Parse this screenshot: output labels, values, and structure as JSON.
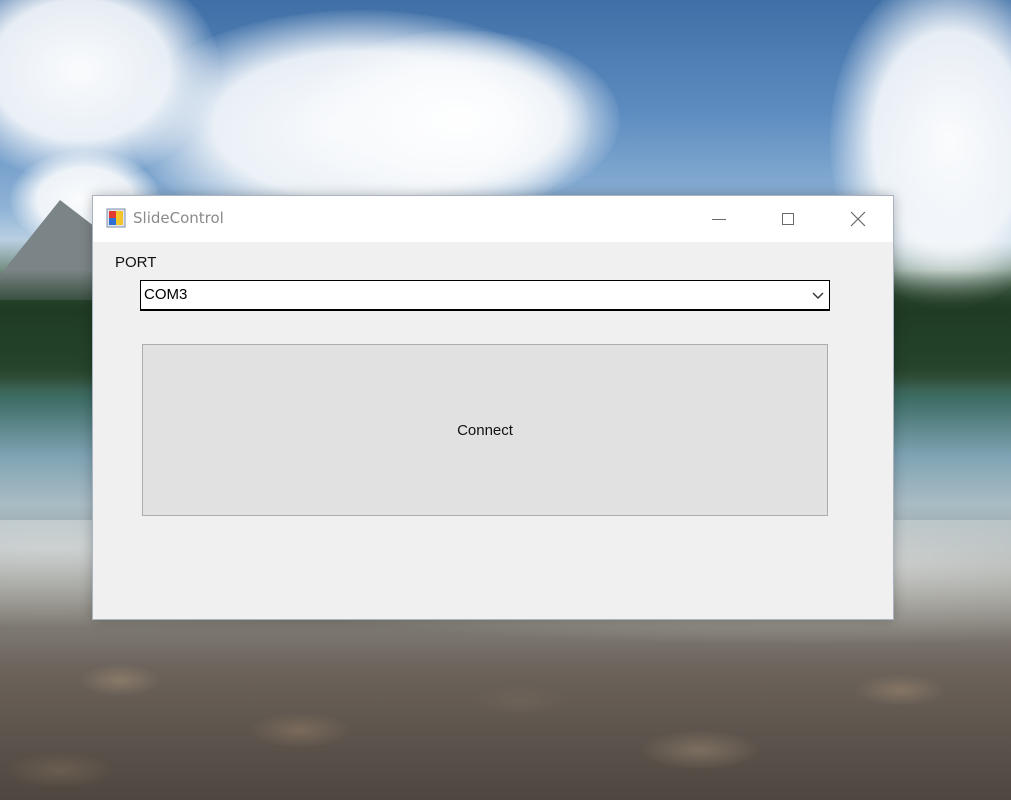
{
  "window": {
    "title": "SlideControl",
    "icon": "application-icon",
    "controls": {
      "minimize": "minimize-icon",
      "maximize": "maximize-icon",
      "close": "close-icon"
    }
  },
  "form": {
    "port_label": "PORT",
    "port_selected": "COM3",
    "connect_label": "Connect"
  },
  "colors": {
    "window_bg": "#f0f0f0",
    "titlebar_bg": "#ffffff",
    "button_bg": "#e1e1e1",
    "title_text": "#8a8a8a"
  }
}
